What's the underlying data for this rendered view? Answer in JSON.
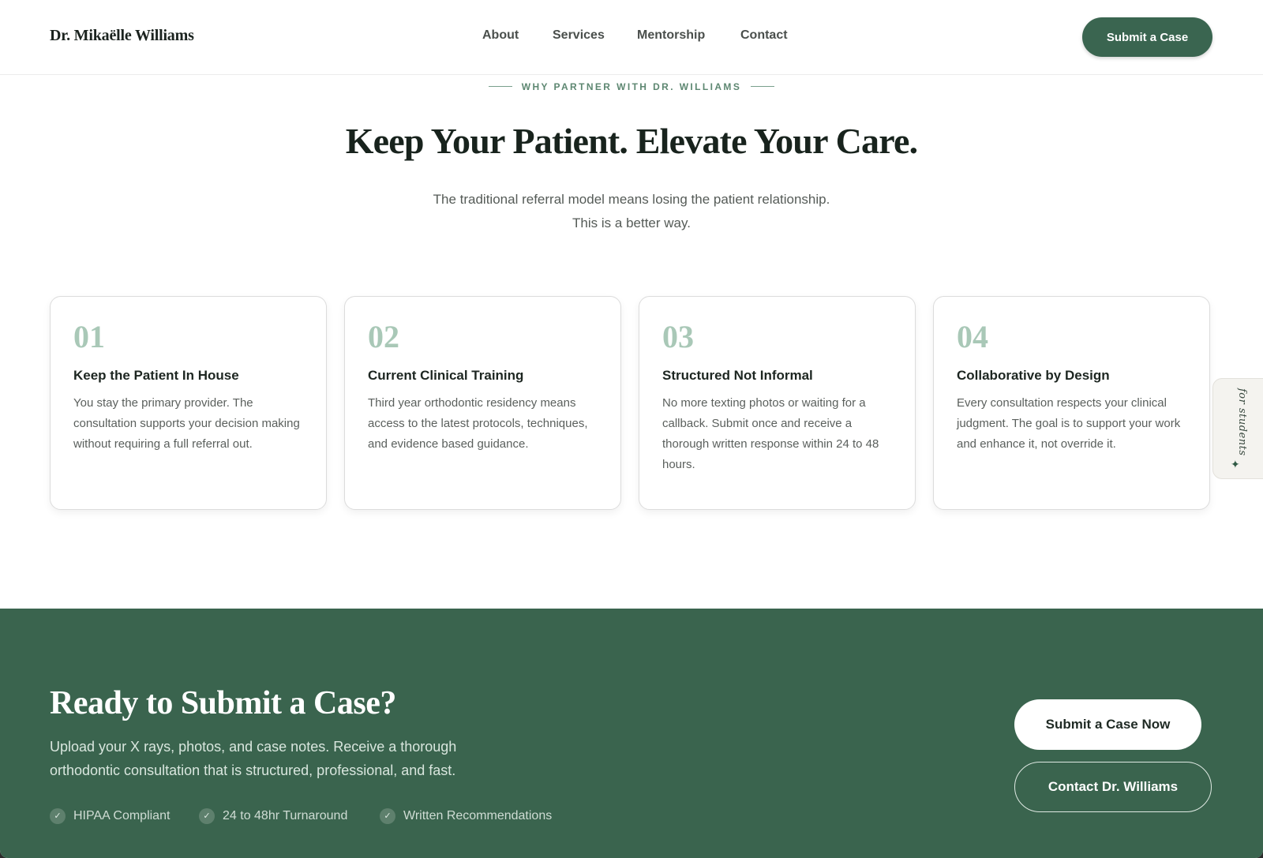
{
  "header": {
    "brand": "Dr. Mikaëlle Williams",
    "nav": [
      "About",
      "Services",
      "Mentorship",
      "Contact"
    ],
    "cta_label": "Submit a Case"
  },
  "intro": {
    "eyebrow": "WHY PARTNER WITH DR. WILLIAMS",
    "title": "Keep Your Patient. Elevate Your Care.",
    "subtitle_line1": "The traditional referral model means losing the patient relationship.",
    "subtitle_line2": "This is a better way."
  },
  "cards": [
    {
      "number": "01",
      "title": "Keep the Patient In House",
      "body": "You stay the primary provider. The consultation supports your decision making without requiring a full referral out."
    },
    {
      "number": "02",
      "title": "Current Clinical Training",
      "body": "Third year orthodontic residency means access to the latest protocols, techniques, and evidence based guidance."
    },
    {
      "number": "03",
      "title": "Structured Not Informal",
      "body": "No more texting photos or waiting for a callback. Submit once and receive a thorough written response within 24 to 48 hours."
    },
    {
      "number": "04",
      "title": "Collaborative by Design",
      "body": "Every consultation respects your clinical judgment. The goal is to support your work and enhance it, not override it."
    }
  ],
  "side_tab": {
    "label": "for students",
    "icon": "sparkle-icon"
  },
  "cta": {
    "title": "Ready to Submit a Case?",
    "text": "Upload your X rays, photos, and case notes. Receive a thorough orthodontic consultation that is structured, professional, and fast.",
    "badges": [
      "HIPAA Compliant",
      "24 to 48hr Turnaround",
      "Written Recommendations"
    ],
    "primary_label": "Submit a Case Now",
    "secondary_label": "Contact Dr. Williams"
  },
  "colors": {
    "brand_green": "#3a644e",
    "accent_numbers": "#a9c8b7",
    "white": "#ffffff"
  }
}
